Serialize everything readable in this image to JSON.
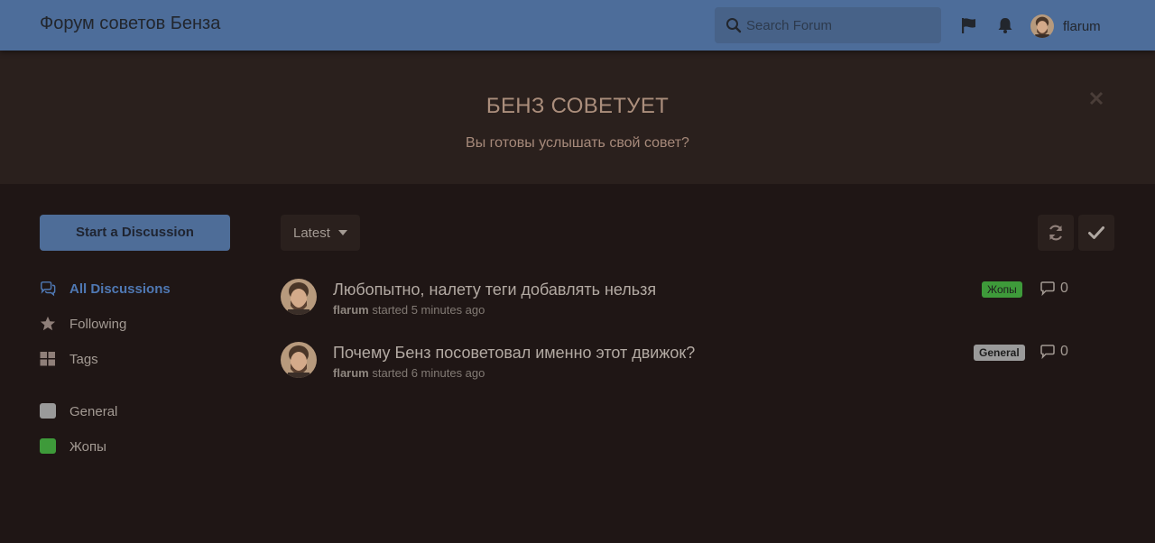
{
  "header": {
    "site_title": "Форум советов Бенза",
    "search_placeholder": "Search Forum",
    "username": "flarum"
  },
  "hero": {
    "title": "БЕНЗ СОВЕТУЕТ",
    "subtitle": "Вы готовы услышать свой совет?"
  },
  "sidebar": {
    "start_button": "Start a Discussion",
    "nav": [
      {
        "label": "All Discussions",
        "icon": "comments-icon",
        "active": true
      },
      {
        "label": "Following",
        "icon": "star-icon",
        "active": false
      },
      {
        "label": "Tags",
        "icon": "tags-grid-icon",
        "active": false
      }
    ],
    "tags": [
      {
        "label": "General",
        "color": "#9a9a9a"
      },
      {
        "label": "Жопы",
        "color": "#3e9a3a"
      }
    ]
  },
  "toolbar": {
    "sort_label": "Latest",
    "refresh_icon": "refresh-icon",
    "mark_read_icon": "check-icon"
  },
  "discussions": [
    {
      "title": "Любопытно, налету теги добавлять нельзя",
      "author": "flarum",
      "started": "started 5 minutes ago",
      "tag": "Жопы",
      "tag_color": "#3e9a3a",
      "replies": "0"
    },
    {
      "title": "Почему Бенз посоветовал именно этот движок?",
      "author": "flarum",
      "started": "started 6 minutes ago",
      "tag": "General",
      "tag_color": "#9a9a9a",
      "replies": "0"
    }
  ],
  "colors": {
    "header_bg": "#4d6d9a",
    "page_bg": "#1f1615",
    "hero_bg": "#2a201d",
    "accent": "#4f78b3"
  }
}
